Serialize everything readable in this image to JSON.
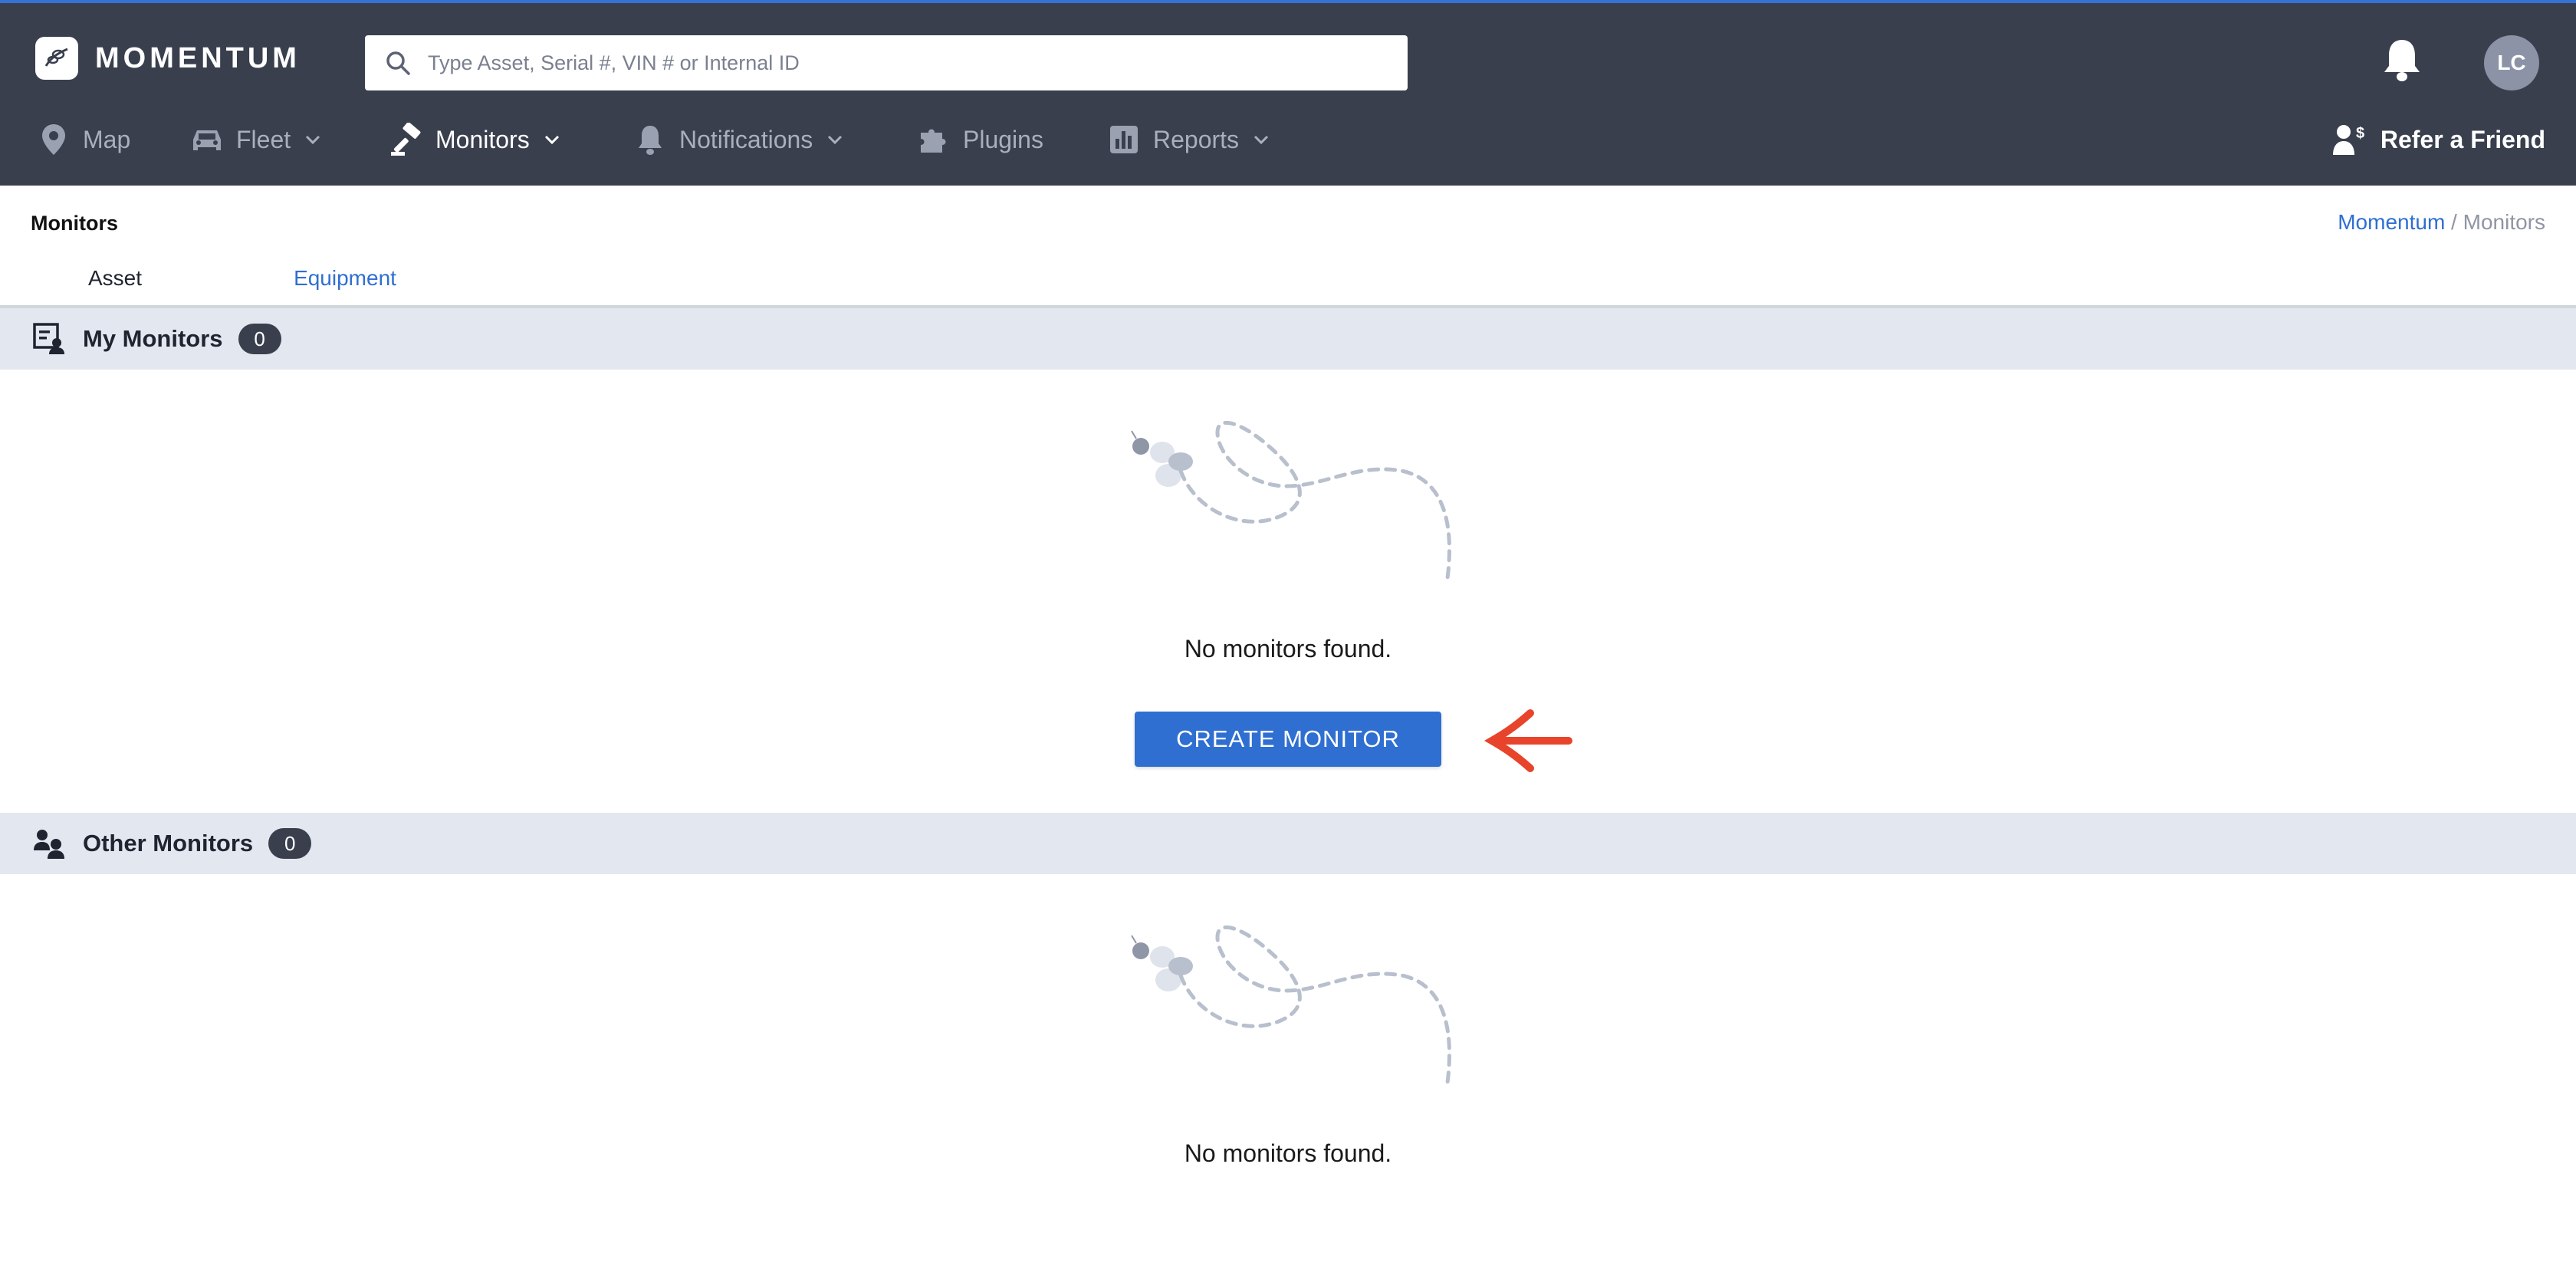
{
  "header": {
    "brand": "MOMENTUM",
    "search_placeholder": "Type Asset, Serial #, VIN # or Internal ID",
    "avatar_initials": "LC",
    "refer_label": "Refer a Friend"
  },
  "nav": {
    "items": [
      {
        "label": "Map",
        "icon": "map-pin-icon",
        "dropdown": false
      },
      {
        "label": "Fleet",
        "icon": "car-icon",
        "dropdown": true
      },
      {
        "label": "Monitors",
        "icon": "gavel-icon",
        "dropdown": true,
        "active": true
      },
      {
        "label": "Notifications",
        "icon": "bell-icon",
        "dropdown": true
      },
      {
        "label": "Plugins",
        "icon": "puzzle-icon",
        "dropdown": false
      },
      {
        "label": "Reports",
        "icon": "bar-chart-icon",
        "dropdown": true
      }
    ]
  },
  "page": {
    "title": "Monitors",
    "breadcrumb": {
      "root": "Momentum",
      "separator": " / ",
      "current": "Monitors"
    },
    "tabs": [
      {
        "label": "Asset"
      },
      {
        "label": "Equipment",
        "active": true
      }
    ]
  },
  "sections": {
    "my": {
      "title": "My Monitors",
      "count": "0",
      "empty_text": "No monitors found.",
      "button_label": "CREATE MONITOR"
    },
    "other": {
      "title": "Other Monitors",
      "count": "0",
      "empty_text": "No monitors found."
    }
  },
  "colors": {
    "header_bg": "#393f4d",
    "accent": "#2f6fd1",
    "section_bg": "#e3e7f0",
    "annotation_arrow": "#e8442c"
  }
}
